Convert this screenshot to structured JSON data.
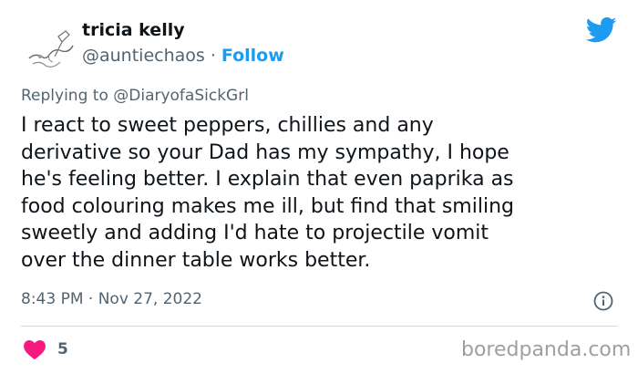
{
  "author": {
    "name": "tricia kelly",
    "handle": "@auntiechaos",
    "separator": "·",
    "follow_label": "Follow"
  },
  "reply": {
    "prefix": "Replying to",
    "mention": "@DiaryofaSickGrl"
  },
  "tweet": {
    "lines": [
      "I react to sweet peppers, chillies and any",
      "derivative so your Dad has my sympathy, I hope",
      "he's feeling better. I explain that even paprika as",
      "food colouring makes me ill, but find that smiling",
      "sweetly and adding I'd hate to projectile vomit",
      "over the dinner table works better."
    ],
    "timestamp": "8:43 PM · Nov 27, 2022"
  },
  "engagement": {
    "likes": "5"
  },
  "watermark": "boredpanda.com",
  "colors": {
    "twitter_blue": "#1d9bf0",
    "like_pink": "#f91880",
    "muted_text": "#536471",
    "body_text": "#0f1419",
    "divider": "#cfd9de"
  },
  "icons": {
    "avatar": "avatar-sketch",
    "brand": "twitter-bird-icon",
    "info": "info-icon",
    "like": "heart-icon"
  }
}
